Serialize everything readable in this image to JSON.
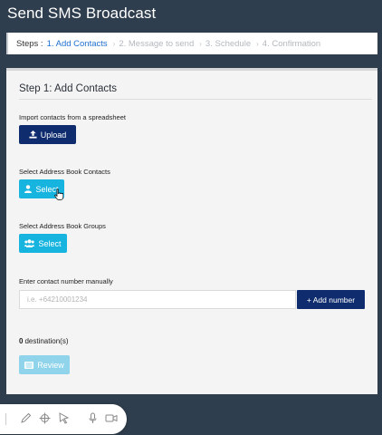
{
  "page": {
    "title": "Send SMS Broadcast"
  },
  "steps": {
    "label": "Steps :",
    "items": [
      {
        "label": "1. Add Contacts",
        "active": true
      },
      {
        "label": "2. Message to send",
        "active": false
      },
      {
        "label": "3. Schedule",
        "active": false
      },
      {
        "label": "4. Confirmation",
        "active": false
      }
    ]
  },
  "panel": {
    "heading": "Step 1: Add Contacts",
    "import": {
      "label": "Import contacts from a spreadsheet",
      "button": "Upload",
      "icon": "upload-icon"
    },
    "address_book": {
      "label": "Select Address Book Contacts",
      "button": "Select",
      "icon": "user-icon"
    },
    "groups": {
      "label": "Select Address Book Groups",
      "button": "Select",
      "icon": "group-icon"
    },
    "manual": {
      "label": "Enter contact number manually",
      "placeholder": "i.e. +64210001234",
      "value": "",
      "button": "+ Add number"
    },
    "destinations": {
      "count": "0",
      "suffix": "destination(s)"
    },
    "review": {
      "button": "Review",
      "icon": "list-icon"
    }
  },
  "toolbar": {
    "tools": [
      "pen-icon",
      "crosshair-icon",
      "pointer-icon",
      "microphone-icon",
      "video-icon"
    ]
  },
  "colors": {
    "background": "#2f3e4e",
    "navy_button": "#0e2c6e",
    "cyan_button": "#17b4df",
    "review_button": "#8fd4ea",
    "active_step": "#1f6fd0",
    "inactive_step": "#b4b9bf"
  }
}
